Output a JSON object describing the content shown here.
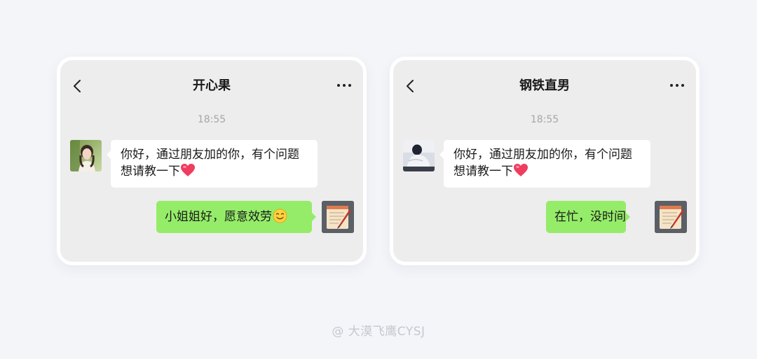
{
  "chats": [
    {
      "title": "开心果",
      "time": "18:55",
      "incoming": {
        "text": "你好，通过朋友加的你，有个问题想请教一下",
        "emoji": "heart-icon",
        "avatar": "avatar-girl-photo"
      },
      "outgoing": {
        "text": "小姐姐好，愿意效劳",
        "emoji": "smile-icon",
        "avatar": "notepad-pencil-avatar"
      }
    },
    {
      "title": "钢铁直男",
      "time": "18:55",
      "incoming": {
        "text": "你好，通过朋友加的你，有个问题想请教一下",
        "emoji": "heart-icon",
        "avatar": "avatar-person-at-desk-photo"
      },
      "outgoing": {
        "text": "在忙，没时间",
        "avatar": "notepad-pencil-avatar"
      }
    }
  ],
  "icons": {
    "back": "chevron-left-icon",
    "more": "more-dots-icon"
  },
  "colors": {
    "chat_bg": "#ededed",
    "outgoing_bubble": "#95ec69",
    "incoming_bubble": "#ffffff",
    "page_bg": "#f4f5f9"
  },
  "watermark": "@ 大漠飞鹰CYSJ"
}
